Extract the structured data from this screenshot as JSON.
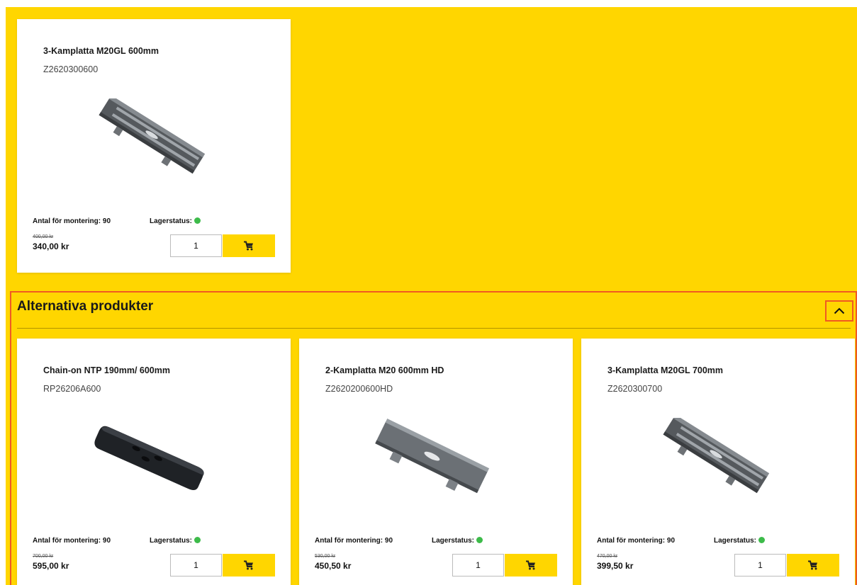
{
  "products": [
    {
      "name": "3-Kamplatta M20GL 600mm",
      "sku": "Z2620300600",
      "image_icon": "track-grouser-plate",
      "antal_label": "Antal för montering: 90",
      "lager_label": "Lagerstatus:",
      "old_price": "400,00 kr",
      "price": "340,00 kr",
      "quantity": "1",
      "cart_icon": "cart-icon"
    }
  ],
  "alternatives": {
    "title": "Alternativa produkter",
    "collapse_icon": "chevron-up-icon",
    "items": [
      {
        "name": "Chain-on NTP 190mm/ 600mm",
        "sku": "RP26206A600",
        "image_icon": "rubber-track-pad",
        "antal_label": "Antal för montering: 90",
        "lager_label": "Lagerstatus:",
        "old_price": "700,00 kr",
        "price": "595,00 kr",
        "quantity": "1"
      },
      {
        "name": "2-Kamplatta M20 600mm HD",
        "sku": "Z2620200600HD",
        "image_icon": "track-grouser-plate",
        "antal_label": "Antal för montering: 90",
        "lager_label": "Lagerstatus:",
        "old_price": "530,00 kr",
        "price": "450,50 kr",
        "quantity": "1"
      },
      {
        "name": "3-Kamplatta M20GL 700mm",
        "sku": "Z2620300700",
        "image_icon": "track-grouser-plate",
        "antal_label": "Antal för montering: 90",
        "lager_label": "Lagerstatus:",
        "old_price": "470,00 kr",
        "price": "399,50 kr",
        "quantity": "1"
      }
    ]
  },
  "colors": {
    "background": "#FFD600",
    "card": "#FFFFFF",
    "highlight_border": "#F05A22",
    "stock_ok": "#3DBB4A"
  }
}
